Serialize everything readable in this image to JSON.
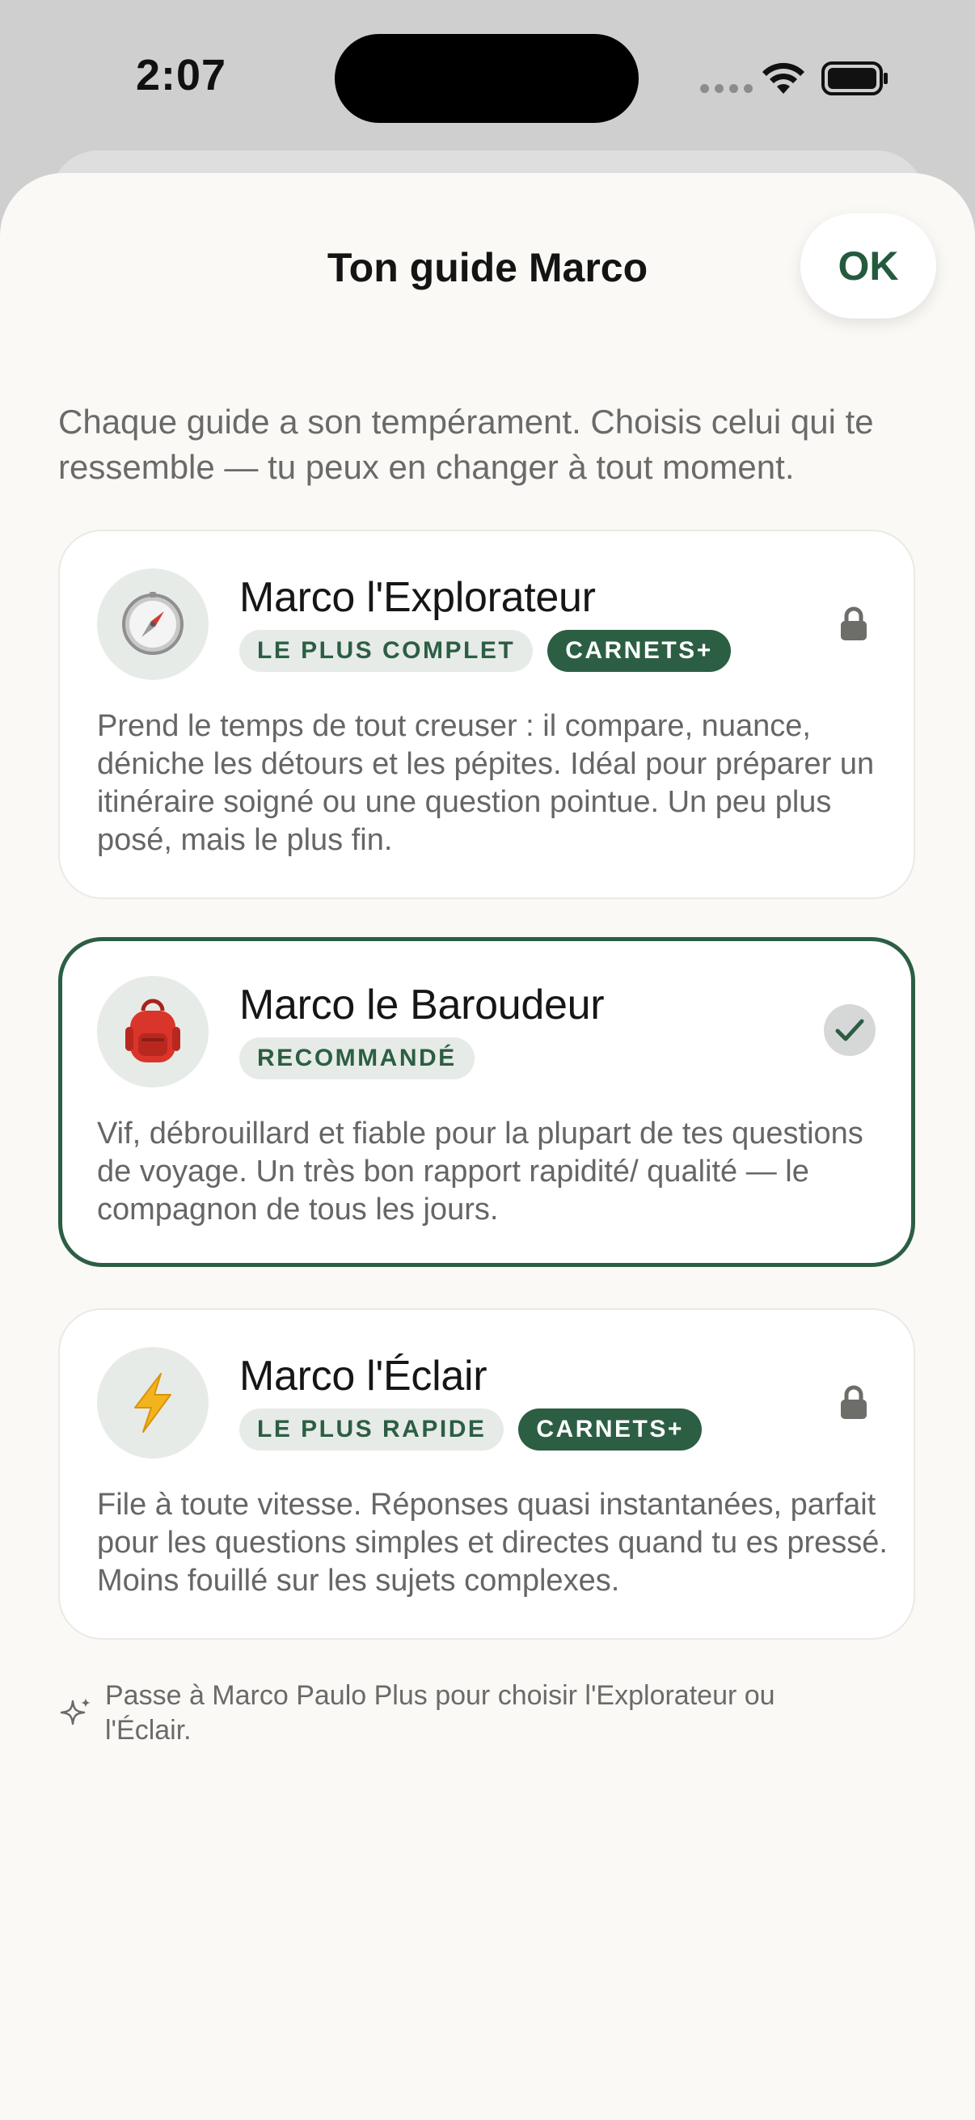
{
  "status_bar": {
    "time": "2:07"
  },
  "sheet": {
    "title": "Ton guide Marco",
    "ok_label": "OK",
    "intro": "Chaque guide a son tempérament. Choisis celui qui te ressemble — tu peux en changer à tout moment."
  },
  "cards": [
    {
      "icon": "compass-icon",
      "title": "Marco l'Explorateur",
      "badges": [
        "LE PLUS COMPLET",
        "CARNETS+"
      ],
      "description": "Prend le temps de tout creuser : il compare, nuance, déniche les détours et les pépites. Idéal pour préparer un itinéraire soigné ou une question pointue. Un peu plus posé, mais le plus fin.",
      "state": "locked"
    },
    {
      "icon": "backpack-icon",
      "title": "Marco le Baroudeur",
      "badges": [
        "RECOMMANDÉ"
      ],
      "description": "Vif, débrouillard et fiable pour la plupart de tes questions de voyage. Un très bon rapport rapidité/ qualité — le compagnon de tous les jours.",
      "state": "selected"
    },
    {
      "icon": "lightning-icon",
      "title": "Marco l'Éclair",
      "badges": [
        "LE PLUS RAPIDE",
        "CARNETS+"
      ],
      "description": "File à toute vitesse. Réponses quasi instantanées, parfait pour les questions simples et directes quand tu es pressé. Moins fouillé sur les sujets complexes.",
      "state": "locked"
    }
  ],
  "footer": {
    "icon": "sparkle-icon",
    "text": "Passe à Marco Paulo Plus pour choisir l'Explorateur ou l'Éclair."
  },
  "colors": {
    "accent": "#2c5e43",
    "badge_light": "#e7ebe7",
    "sheet_background": "#faf9f6"
  }
}
